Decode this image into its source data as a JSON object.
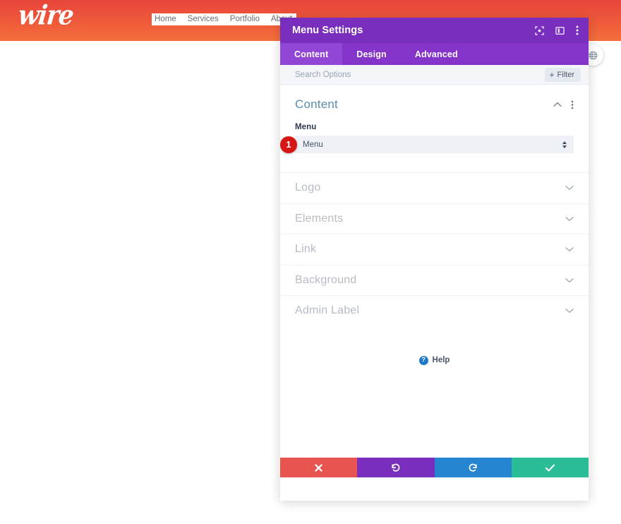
{
  "site": {
    "logo_text": "wire",
    "nav_items": [
      {
        "label": "Home"
      },
      {
        "label": "Services"
      },
      {
        "label": "Portfolio"
      },
      {
        "label": "About"
      }
    ],
    "header_gradient_from": "#e8453c",
    "header_gradient_to": "#f4703c",
    "side_widget_icon": "globe-icon"
  },
  "modal": {
    "title": "Menu Settings",
    "titlebar_color": "#7a2ebd",
    "titlebar_icons": [
      {
        "name": "focus-target-icon"
      },
      {
        "name": "panel-layout-icon"
      },
      {
        "name": "more-vertical-icon"
      }
    ],
    "tabs": [
      {
        "label": "Content",
        "active": true
      },
      {
        "label": "Design",
        "active": false
      },
      {
        "label": "Advanced",
        "active": false
      }
    ],
    "search": {
      "placeholder": "Search Options",
      "value": "",
      "filter_label": "Filter",
      "filter_plus": "+"
    },
    "content_section": {
      "title": "Content",
      "collapse_icon": "chevron-up-icon",
      "more_icon": "more-vertical-icon",
      "field": {
        "label": "Menu",
        "selected_value": "Menu",
        "step_badge": "1",
        "step_badge_color": "#d61515"
      }
    },
    "collapsed_sections": [
      {
        "label": "Logo"
      },
      {
        "label": "Elements"
      },
      {
        "label": "Link"
      },
      {
        "label": "Background"
      },
      {
        "label": "Admin Label"
      }
    ],
    "help": {
      "icon_glyph": "?",
      "label": "Help"
    },
    "footer_actions": [
      {
        "name": "cancel-button",
        "icon": "close-x-icon",
        "color": "#e8544f"
      },
      {
        "name": "undo-button",
        "icon": "undo-arrow-icon",
        "color": "#7a2ebd"
      },
      {
        "name": "redo-button",
        "icon": "redo-arrow-icon",
        "color": "#2585d0"
      },
      {
        "name": "save-button",
        "icon": "check-icon",
        "color": "#2bbd96"
      }
    ]
  }
}
